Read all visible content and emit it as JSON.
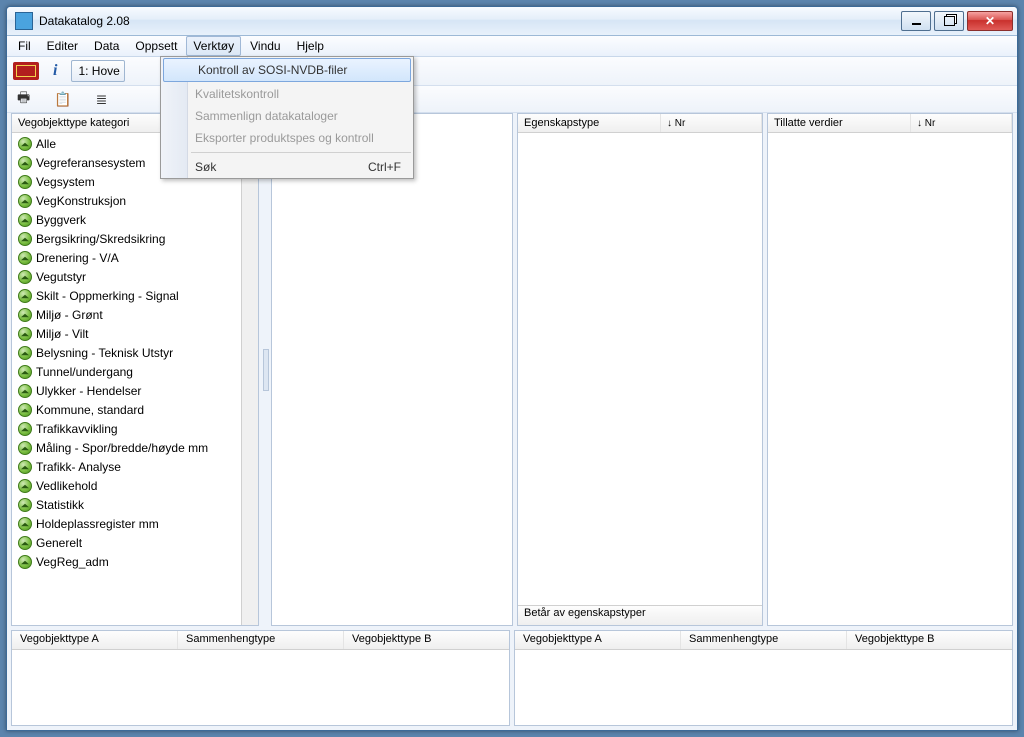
{
  "window": {
    "title": "Datakatalog 2.08"
  },
  "menubar": [
    "Fil",
    "Editer",
    "Data",
    "Oppsett",
    "Verktøy",
    "Vindu",
    "Hjelp"
  ],
  "active_menu_index": 4,
  "toolbar": {
    "combo_label": "1: Hove"
  },
  "dropdown": {
    "items": [
      {
        "label": "Kontroll av SOSI-NVDB-filer",
        "enabled": true,
        "hot": true
      },
      {
        "label": "Kvalitetskontroll",
        "enabled": false
      },
      {
        "label": "Sammenlign datakataloger",
        "enabled": false
      },
      {
        "label": "Eksporter produktspes og kontroll",
        "enabled": false
      },
      {
        "sep": true
      },
      {
        "label": "Søk",
        "enabled": true,
        "shortcut": "Ctrl+F"
      }
    ]
  },
  "tree": {
    "header": "Vegobjekttype kategori",
    "items": [
      "Alle",
      "Vegreferansesystem",
      "Vegsystem",
      "VegKonstruksjon",
      "Byggverk",
      "Bergsikring/Skredsikring",
      "Drenering - V/A",
      "Vegutstyr",
      "Skilt - Oppmerking - Signal",
      "Miljø - Grønt",
      "Miljø - Vilt",
      "Belysning - Teknisk Utstyr",
      "Tunnel/undergang",
      "Ulykker - Hendelser",
      "Kommune, standard",
      "Trafikkavvikling",
      "Måling - Spor/bredde/høyde mm",
      "Trafikk-  Analyse",
      "Vedlikehold",
      "Statistikk",
      "Holdeplassregister mm",
      "Generelt",
      "VegReg_adm"
    ]
  },
  "egenskap": {
    "header_type": "Egenskapstype",
    "header_sort": "↓ Nr",
    "footer": "Betår av egenskapstyper"
  },
  "tillatte": {
    "header_type": "Tillatte verdier",
    "header_sort": "↓ Nr"
  },
  "lower_headers": {
    "a": "Vegobjekttype A",
    "s": "Sammenhengtype",
    "b": "Vegobjekttype B"
  }
}
